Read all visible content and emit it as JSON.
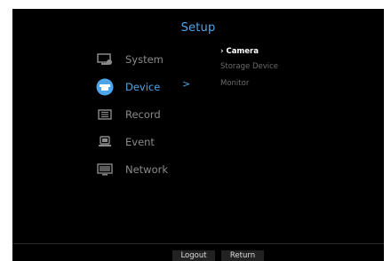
{
  "header": {
    "title": "Setup"
  },
  "menu": {
    "items": [
      {
        "label": "System",
        "icon": "system-icon"
      },
      {
        "label": "Device",
        "icon": "camera-device-icon",
        "active": true
      },
      {
        "label": "Record",
        "icon": "record-icon"
      },
      {
        "label": "Event",
        "icon": "event-icon"
      },
      {
        "label": "Network",
        "icon": "network-icon"
      }
    ],
    "expand_arrow": ">"
  },
  "submenu": {
    "items": [
      {
        "label": "› Camera",
        "active": true
      },
      {
        "label": "Storage Device"
      },
      {
        "label": "Monitor"
      }
    ]
  },
  "footer": {
    "logout_label": "Logout",
    "return_label": "Return"
  },
  "colors": {
    "accent": "#4ea6e8",
    "background": "#000000",
    "inactive_text": "#8a8a8a"
  }
}
